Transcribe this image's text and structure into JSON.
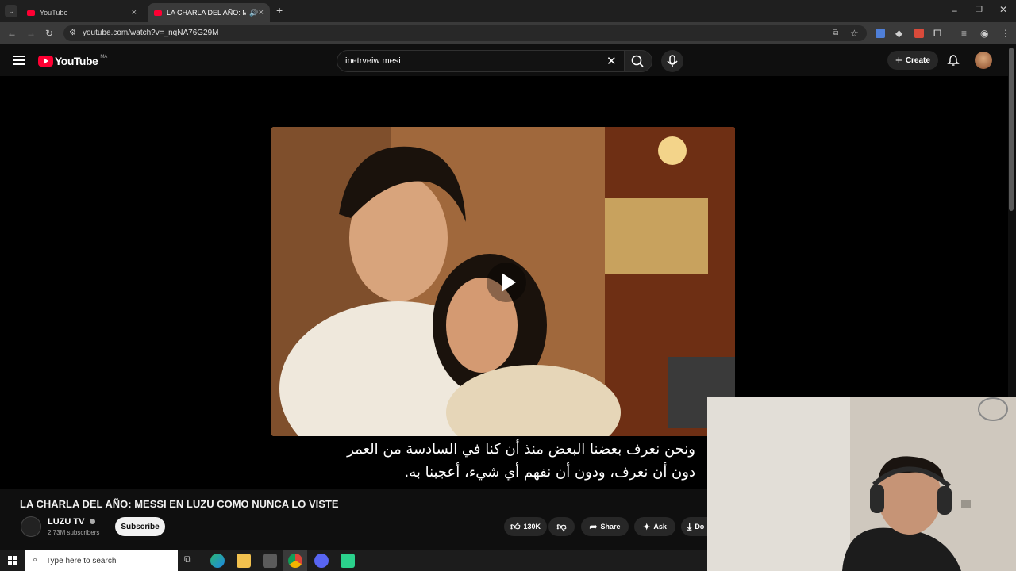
{
  "browser": {
    "tabs": [
      {
        "title": "YouTube"
      },
      {
        "title": "LA CHARLA DEL AÑO: MES"
      }
    ],
    "url": "youtube.com/watch?v=_nqNA76G29M"
  },
  "youtube": {
    "logo_text": "YouTube",
    "region": "MA",
    "search_value": "inetrveiw mesi",
    "create_label": "Create"
  },
  "video": {
    "caption_line1": "ونحن نعرف بعضنا البعض منذ أن كنا في السادسة من العمر",
    "caption_line2": "دون أن نعرف، ودون أن نفهم أي شيء، أعجبنا به.",
    "title": "LA CHARLA DEL AÑO: MESSI EN LUZU COMO NUNCA LO VISTE"
  },
  "channel": {
    "name": "LUZU TV",
    "subscribers": "2.73M subscribers",
    "subscribe_label": "Subscribe"
  },
  "actions": {
    "likes": "130K",
    "share_label": "Share",
    "ask_label": "Ask",
    "download_label": "Do"
  },
  "taskbar": {
    "search_placeholder": "Type here to search"
  }
}
